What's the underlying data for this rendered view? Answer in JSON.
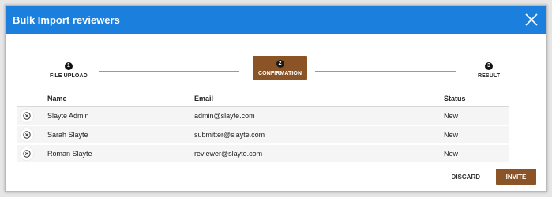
{
  "dialog": {
    "title": "Bulk Import reviewers",
    "header_color": "#1b7fde",
    "close_icon": "close-icon"
  },
  "stepper": {
    "steps": [
      {
        "number": "1",
        "label": "FILE UPLOAD",
        "active": false
      },
      {
        "number": "2",
        "label": "CONFIRMATION",
        "active": true
      },
      {
        "number": "3",
        "label": "RESULT",
        "active": false
      }
    ],
    "active_color": "#8a5427"
  },
  "table": {
    "columns": [
      "Name",
      "Email",
      "Status"
    ],
    "rows": [
      {
        "name": "Slayte Admin",
        "email": "admin@slayte.com",
        "status": "New"
      },
      {
        "name": "Sarah Slayte",
        "email": "submitter@slayte.com",
        "status": "New"
      },
      {
        "name": "Roman Slayte",
        "email": "reviewer@slayte.com",
        "status": "New"
      }
    ],
    "row_action_icon": "remove-circle-icon"
  },
  "actions": {
    "discard_label": "DISCARD",
    "invite_label": "INVITE"
  }
}
